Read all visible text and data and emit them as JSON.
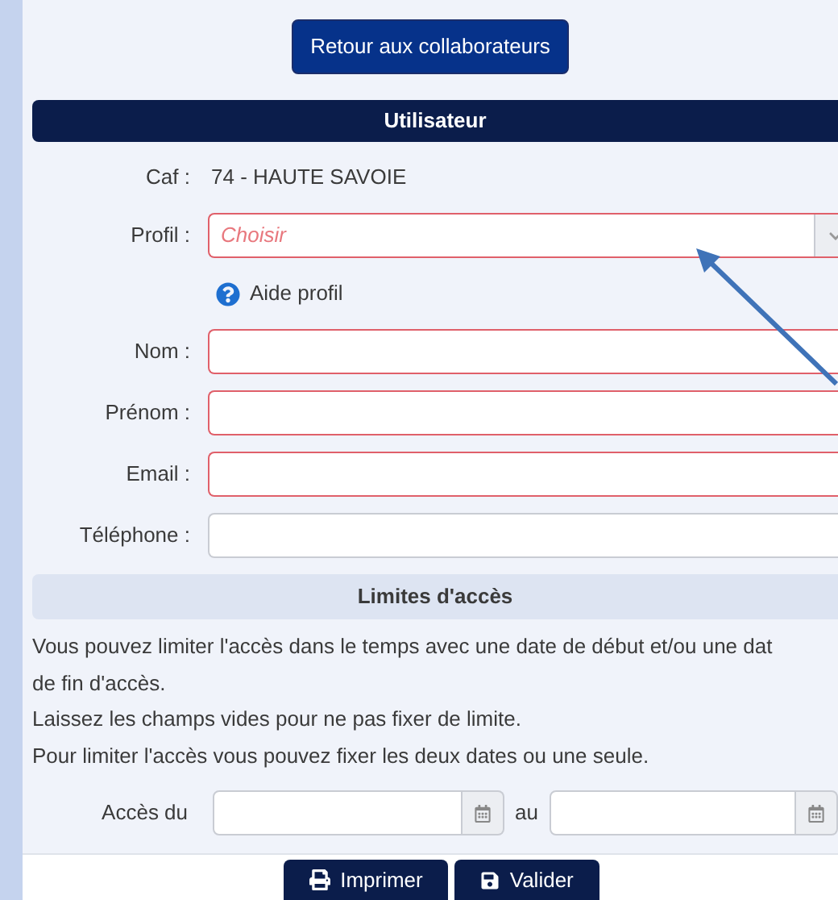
{
  "back_button": "Retour aux collaborateurs",
  "section_title": "Utilisateur",
  "caf": {
    "label": "Caf :",
    "value": "74 - HAUTE SAVOIE"
  },
  "profile": {
    "label": "Profil :",
    "placeholder": "Choisir",
    "invalid": true
  },
  "help_link": "Aide profil",
  "fields": [
    {
      "label": "Nom :",
      "invalid": true
    },
    {
      "label": "Prénom :",
      "invalid": true
    },
    {
      "label": "Email :",
      "invalid": true
    },
    {
      "label": "Téléphone :",
      "invalid": false
    }
  ],
  "access": {
    "title": "Limites d'accès",
    "lines": [
      "Vous pouvez limiter l'accès dans le temps avec une date de début et/ou une dat",
      "de fin d'accès.",
      "Laissez les champs vides pour ne pas fixer de limite.",
      "Pour limiter l'accès vous pouvez fixer les deux dates ou une seule."
    ],
    "from_label": "Accès du",
    "to_label": "au"
  },
  "buttons": [
    {
      "label": "Imprimer",
      "kind": "print"
    },
    {
      "label": "Valider",
      "kind": "save"
    }
  ]
}
